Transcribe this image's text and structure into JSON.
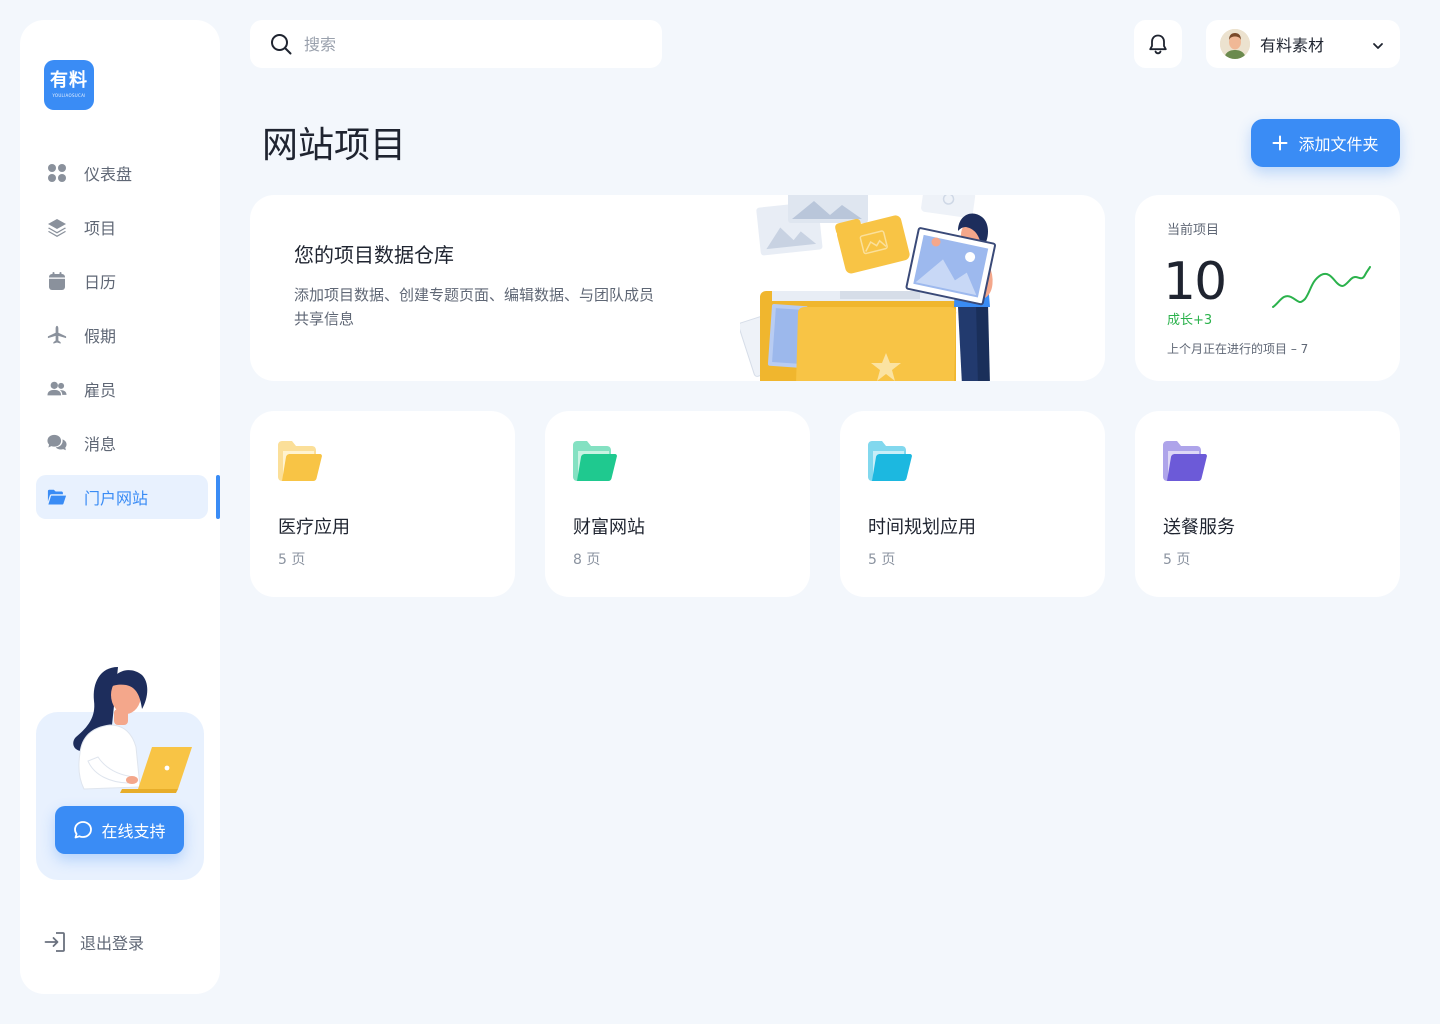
{
  "sidebar": {
    "logo": {
      "main": "有料",
      "sub": "YOULIAOSUCAI"
    },
    "items": [
      {
        "label": "仪表盘",
        "icon": "dashboard-icon"
      },
      {
        "label": "项目",
        "icon": "layers-icon"
      },
      {
        "label": "日历",
        "icon": "calendar-icon"
      },
      {
        "label": "假期",
        "icon": "airplane-icon"
      },
      {
        "label": "雇员",
        "icon": "users-icon"
      },
      {
        "label": "消息",
        "icon": "chat-icon"
      },
      {
        "label": "门户网站",
        "icon": "folder-open-icon",
        "active": true
      }
    ],
    "support_label": "在线支持",
    "logout_label": "退出登录"
  },
  "topbar": {
    "search_placeholder": "搜索",
    "user_name": "有料素材"
  },
  "page": {
    "title": "网站项目",
    "add_folder_label": "添加文件夹"
  },
  "hero": {
    "title": "您的项目数据仓库",
    "description": "添加项目数据、创建专题页面、编辑数据、与团队成员共享信息"
  },
  "stats": {
    "label": "当前项目",
    "value": "10",
    "growth": "成长+3",
    "footnote": "上个月正在进行的项目 – 7"
  },
  "folders": [
    {
      "name": "医疗应用",
      "count": "5 页",
      "color": "#f8c445"
    },
    {
      "name": "财富网站",
      "count": "8 页",
      "color": "#1fc98f"
    },
    {
      "name": "时间规划应用",
      "count": "5 页",
      "color": "#1cb8e0"
    },
    {
      "name": "送餐服务",
      "count": "5 页",
      "color": "#6c5ad8"
    }
  ],
  "colors": {
    "primary": "#3a8cf5",
    "background": "#f3f7fc",
    "growth": "#2bb24c"
  }
}
